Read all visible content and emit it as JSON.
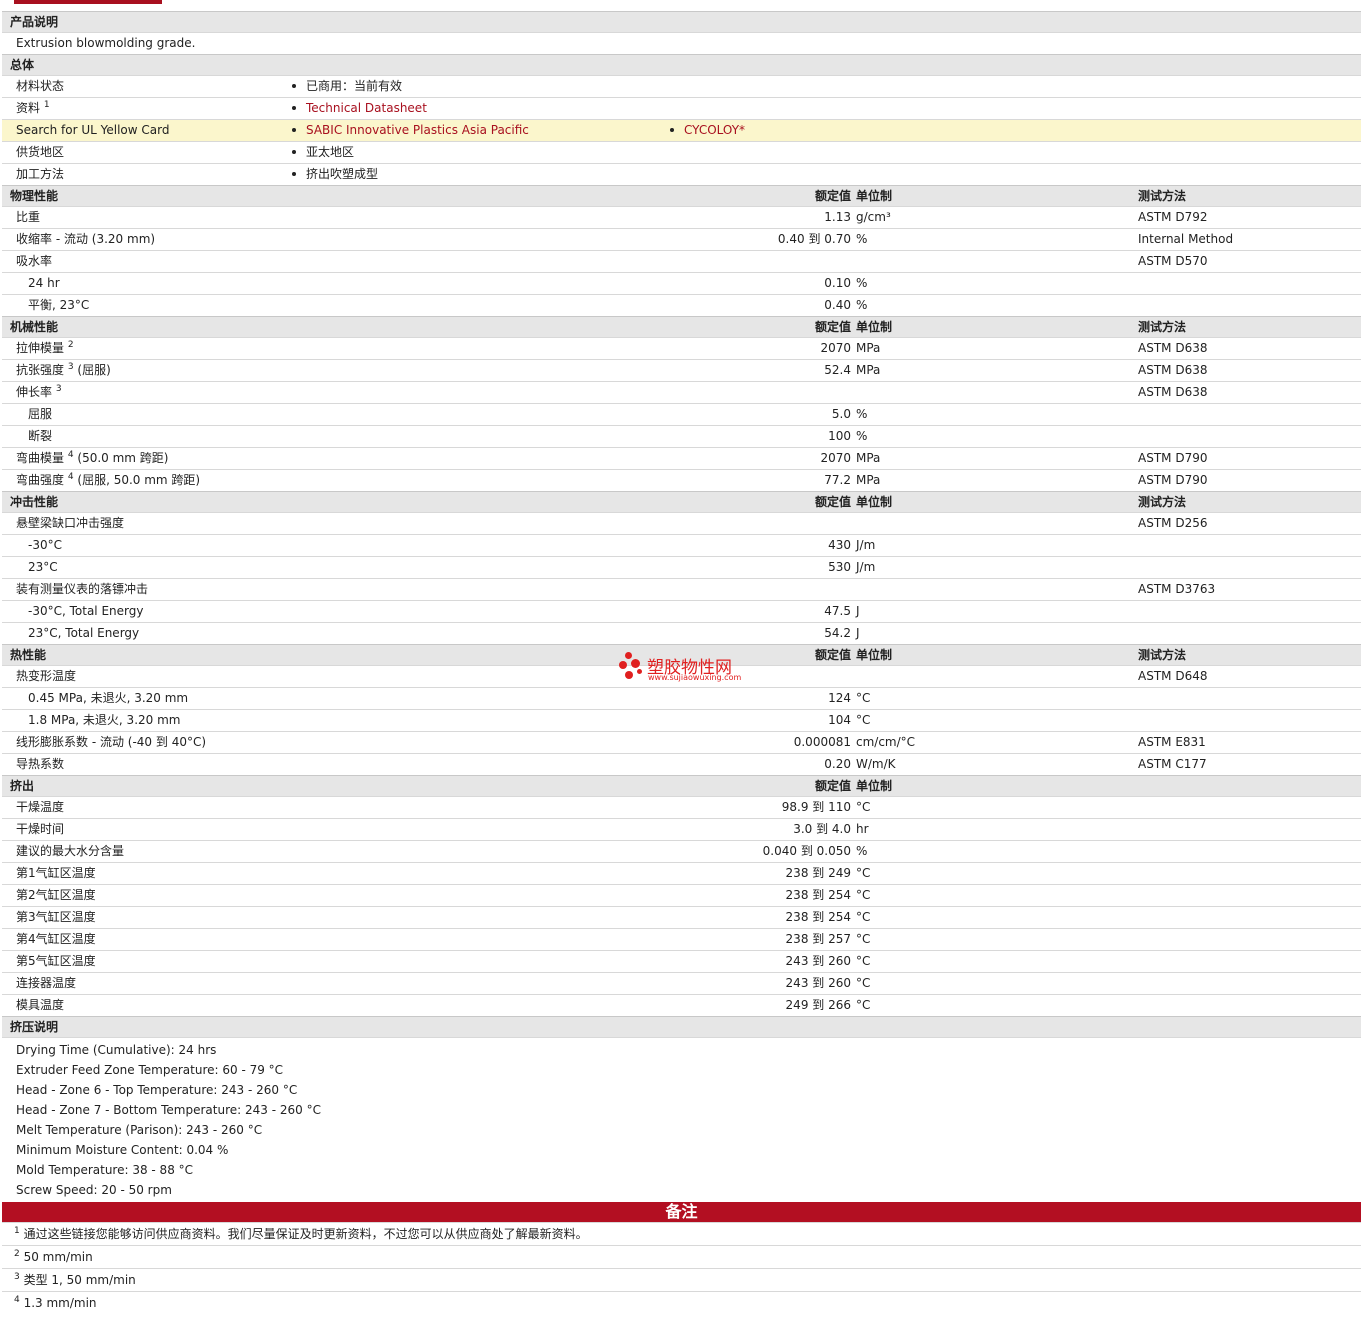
{
  "product_description": {
    "title": "产品说明",
    "text": "Extrusion blowmolding grade."
  },
  "general": {
    "title": "总体",
    "rows": [
      {
        "label": "材料状态",
        "sup": "",
        "items": [
          {
            "text": "已商用：当前有效",
            "link": false
          }
        ]
      },
      {
        "label": "资料",
        "sup": "1",
        "items": [
          {
            "text": "Technical Datasheet",
            "link": true
          }
        ]
      },
      {
        "label": "Search for UL Yellow Card",
        "sup": "",
        "highlight": true,
        "items": [
          {
            "text": "SABIC Innovative Plastics Asia Pacific",
            "link": true
          },
          {
            "text": "CYCOLOY*",
            "link": true
          }
        ]
      },
      {
        "label": "供货地区",
        "sup": "",
        "items": [
          {
            "text": "亚太地区",
            "link": false
          }
        ]
      },
      {
        "label": "加工方法",
        "sup": "",
        "items": [
          {
            "text": "挤出吹塑成型",
            "link": false
          }
        ]
      }
    ]
  },
  "headers": {
    "value": "额定值",
    "unit": "单位制",
    "test": "测试方法"
  },
  "sections": [
    {
      "title": "物理性能",
      "show_test": true,
      "rows": [
        {
          "label": "比重",
          "sup": "",
          "suffix": "",
          "value": "1.13",
          "unit": "g/cm³",
          "test": "ASTM D792"
        },
        {
          "label": "收缩率",
          "sup": "",
          "suffix": " - 流动  (3.20 mm)",
          "value": "0.40 到  0.70",
          "unit": "%",
          "test": "Internal Method"
        },
        {
          "label": "吸水率",
          "sup": "",
          "suffix": "",
          "value": "",
          "unit": "",
          "test": "ASTM D570"
        },
        {
          "label": "24 hr",
          "sub": true,
          "sup": "",
          "suffix": "",
          "value": "0.10",
          "unit": "%",
          "test": ""
        },
        {
          "label": "平衡, 23°C",
          "sub": true,
          "sup": "",
          "suffix": "",
          "value": "0.40",
          "unit": "%",
          "test": ""
        }
      ]
    },
    {
      "title": "机械性能",
      "show_test": true,
      "rows": [
        {
          "label": "拉伸模量",
          "sup": "2",
          "suffix": "",
          "value": "2070",
          "unit": "MPa",
          "test": "ASTM D638"
        },
        {
          "label": "抗张强度",
          "sup": "3",
          "suffix": " (屈服)",
          "value": "52.4",
          "unit": "MPa",
          "test": "ASTM D638"
        },
        {
          "label": "伸长率",
          "sup": "3",
          "suffix": "",
          "value": "",
          "unit": "",
          "test": "ASTM D638"
        },
        {
          "label": "屈服",
          "sub": true,
          "sup": "",
          "suffix": "",
          "value": "5.0",
          "unit": "%",
          "test": ""
        },
        {
          "label": "断裂",
          "sub": true,
          "sup": "",
          "suffix": "",
          "value": "100",
          "unit": "%",
          "test": ""
        },
        {
          "label": "弯曲模量",
          "sup": "4",
          "suffix": " (50.0 mm 跨距)",
          "value": "2070",
          "unit": "MPa",
          "test": "ASTM D790"
        },
        {
          "label": "弯曲强度",
          "sup": "4",
          "suffix": " (屈服, 50.0 mm 跨距)",
          "value": "77.2",
          "unit": "MPa",
          "test": "ASTM D790"
        }
      ]
    },
    {
      "title": "冲击性能",
      "show_test": true,
      "rows": [
        {
          "label": "悬壁梁缺口冲击强度",
          "sup": "",
          "suffix": "",
          "value": "",
          "unit": "",
          "test": "ASTM D256"
        },
        {
          "label": "-30°C",
          "sub": true,
          "sup": "",
          "suffix": "",
          "value": "430",
          "unit": "J/m",
          "test": ""
        },
        {
          "label": "23°C",
          "sub": true,
          "sup": "",
          "suffix": "",
          "value": "530",
          "unit": "J/m",
          "test": ""
        },
        {
          "label": "装有测量仪表的落镖冲击",
          "sup": "",
          "suffix": "",
          "value": "",
          "unit": "",
          "test": "ASTM D3763"
        },
        {
          "label": "-30°C, Total Energy",
          "sub": true,
          "sup": "",
          "suffix": "",
          "value": "47.5",
          "unit": "J",
          "test": ""
        },
        {
          "label": "23°C, Total Energy",
          "sub": true,
          "sup": "",
          "suffix": "",
          "value": "54.2",
          "unit": "J",
          "test": ""
        }
      ]
    },
    {
      "title": "热性能",
      "show_test": true,
      "rows": [
        {
          "label": "热变形温度",
          "sup": "",
          "suffix": "",
          "value": "",
          "unit": "",
          "test": "ASTM D648"
        },
        {
          "label": "0.45 MPa, 未退火, 3.20 mm",
          "sub": true,
          "sup": "",
          "suffix": "",
          "value": "124",
          "unit": "°C",
          "test": ""
        },
        {
          "label": "1.8 MPa, 未退火, 3.20 mm",
          "sub": true,
          "sup": "",
          "suffix": "",
          "value": "104",
          "unit": "°C",
          "test": ""
        },
        {
          "label": "线形膨胀系数",
          "sup": "",
          "suffix": " - 流动  (-40 到  40°C)",
          "value": "0.000081",
          "unit": "cm/cm/°C",
          "test": "ASTM E831"
        },
        {
          "label": "导热系数",
          "sup": "",
          "suffix": "",
          "value": "0.20",
          "unit": "W/m/K",
          "test": "ASTM C177"
        }
      ]
    },
    {
      "title": "挤出",
      "show_test": false,
      "rows": [
        {
          "label": "干燥温度",
          "sup": "",
          "suffix": "",
          "value": "98.9 到  110",
          "unit": "°C",
          "test": ""
        },
        {
          "label": "干燥时间",
          "sup": "",
          "suffix": "",
          "value": "3.0 到  4.0",
          "unit": "hr",
          "test": ""
        },
        {
          "label": "建议的最大水分含量",
          "sup": "",
          "suffix": "",
          "value": "0.040 到  0.050",
          "unit": "%",
          "test": ""
        },
        {
          "label": "第1气缸区温度",
          "sup": "",
          "suffix": "",
          "value": "238 到  249",
          "unit": "°C",
          "test": ""
        },
        {
          "label": "第2气缸区温度",
          "sup": "",
          "suffix": "",
          "value": "238 到  254",
          "unit": "°C",
          "test": ""
        },
        {
          "label": "第3气缸区温度",
          "sup": "",
          "suffix": "",
          "value": "238 到  254",
          "unit": "°C",
          "test": ""
        },
        {
          "label": "第4气缸区温度",
          "sup": "",
          "suffix": "",
          "value": "238 到  257",
          "unit": "°C",
          "test": ""
        },
        {
          "label": "第5气缸区温度",
          "sup": "",
          "suffix": "",
          "value": "243 到  260",
          "unit": "°C",
          "test": ""
        },
        {
          "label": "连接器温度",
          "sup": "",
          "suffix": "",
          "value": "243 到  260",
          "unit": "°C",
          "test": ""
        },
        {
          "label": "模具温度",
          "sup": "",
          "suffix": "",
          "value": "249 到  266",
          "unit": "°C",
          "test": ""
        }
      ]
    }
  ],
  "extrusion_notes": {
    "title": "挤压说明",
    "lines": [
      "Drying Time (Cumulative): 24 hrs",
      "Extruder Feed Zone Temperature: 60 - 79 °C",
      "Head - Zone 6 - Top Temperature: 243 - 260 °C",
      "Head - Zone 7 - Bottom Temperature: 243 - 260 °C",
      "Melt Temperature (Parison): 243 - 260 °C",
      "Minimum Moisture Content: 0.04 %",
      "Mold Temperature: 38 - 88 °C",
      "Screw Speed: 20 - 50 rpm"
    ]
  },
  "remarks": {
    "title": "备注",
    "footnotes": [
      {
        "num": "1",
        "text": "通过这些链接您能够访问供应商资料。我们尽量保证及时更新资料，不过您可以从供应商处了解最新资料。"
      },
      {
        "num": "2",
        "text": "50 mm/min"
      },
      {
        "num": "3",
        "text": "类型  1, 50 mm/min"
      },
      {
        "num": "4",
        "text": "1.3 mm/min"
      }
    ]
  },
  "watermark": {
    "name": "塑胶物性网",
    "url": "www.sujiaowuxing.com"
  }
}
